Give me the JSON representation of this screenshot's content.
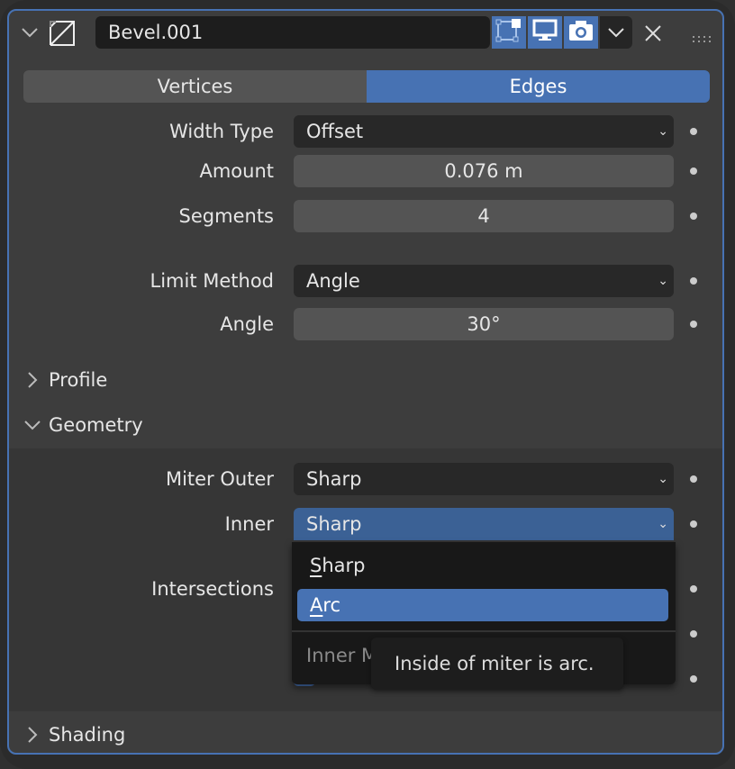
{
  "header": {
    "modifier_name": "Bevel.001",
    "icons": [
      "collapse-chevron-icon",
      "bevel-modifier-icon",
      "edit-mode-toggle-icon",
      "viewport-display-icon",
      "render-camera-icon",
      "dropdown-chevron-icon",
      "close-icon",
      "drag-handle-icon"
    ]
  },
  "tabs": [
    {
      "label": "Vertices",
      "active": false
    },
    {
      "label": "Edges",
      "active": true
    }
  ],
  "fields": {
    "width_type": {
      "label": "Width Type",
      "value": "Offset"
    },
    "amount": {
      "label": "Amount",
      "value": "0.076 m"
    },
    "segments": {
      "label": "Segments",
      "value": "4"
    },
    "limit_method": {
      "label": "Limit Method",
      "value": "Angle"
    },
    "angle": {
      "label": "Angle",
      "value": "30°"
    }
  },
  "subpanels": {
    "profile": "Profile",
    "geometry": "Geometry",
    "shading": "Shading"
  },
  "geometry": {
    "miter_outer": {
      "label": "Miter Outer",
      "value": "Sharp"
    },
    "inner": {
      "label": "Inner",
      "value": "Sharp"
    },
    "intersections": {
      "label": "Intersections"
    }
  },
  "popup": {
    "items": [
      {
        "label": "Sharp",
        "mnemonic": "S"
      },
      {
        "label": "Arc",
        "mnemonic": "A",
        "highlighted": true
      }
    ],
    "title": "Inner M"
  },
  "tooltip": "Inside of miter is arc.",
  "colors": {
    "accent": "#4772b3",
    "panel_bg": "#3d3d3d",
    "field_bg": "#282828",
    "number_bg": "#545454"
  }
}
